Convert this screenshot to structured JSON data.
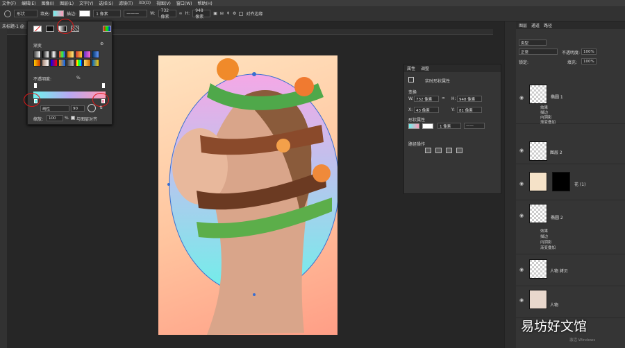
{
  "menu": [
    "文件(F)",
    "编辑(E)",
    "图像(I)",
    "图层(L)",
    "文字(Y)",
    "选择(S)",
    "滤镜(T)",
    "3D(D)",
    "视图(V)",
    "窗口(W)",
    "帮助(H)"
  ],
  "options": {
    "mode": "形状",
    "fill_label": "填充:",
    "stroke_label": "描边:",
    "stroke_size": "1 像素",
    "w_label": "W:",
    "w_value": "732 像素",
    "h_label": "H:",
    "h_value": "948 像素",
    "align_label": "对齐边缘"
  },
  "doc_tab": "未标题-1 @",
  "gradient_panel": {
    "preset_label": "渐变",
    "opacity_label": "不透明度:",
    "percent": "%",
    "type_label": "线性",
    "angle": "90",
    "scale_label": "缩放:",
    "scale_value": "100",
    "scale_unit": "%",
    "align_label": "与图层对齐"
  },
  "properties": {
    "tab1": "属性",
    "tab2": "调整",
    "title": "实时形状属性",
    "transform_label": "变换",
    "w_label": "W:",
    "w_value": "732 像素",
    "h_label": "H:",
    "h_value": "948 像素",
    "x_label": "X:",
    "x_value": "43 像素",
    "y_label": "Y:",
    "y_value": "81 像素",
    "shape_label": "形状属性",
    "stroke_size": "1 像素",
    "path_ops": "路径操作"
  },
  "layers": {
    "tabs": [
      "图层",
      "通道",
      "路径"
    ],
    "filter": "类型",
    "blend": "正常",
    "opacity_label": "不透明度:",
    "opacity": "100%",
    "lock_label": "锁定:",
    "fill_label": "填充:",
    "fill": "100%",
    "items": [
      {
        "name": "椭圆 1",
        "fx": [
          "效果",
          "描边",
          "内阴影",
          "渐变叠加"
        ]
      },
      {
        "name": "图层 2",
        "fx": []
      },
      {
        "name": "花 (1)",
        "fx": []
      },
      {
        "name": "椭圆 2",
        "fx": [
          "效果",
          "描边",
          "内阴影",
          "渐变叠加"
        ]
      },
      {
        "name": "人物 拷贝",
        "fx": []
      },
      {
        "name": "人物",
        "fx": []
      }
    ]
  },
  "watermark": "易坊好文馆",
  "windows_text": "激活 Windows",
  "colors": {
    "ellipse_top": "#f5a8e6",
    "ellipse_bottom": "#6ff0ea",
    "accent": "#3a7bd5"
  }
}
